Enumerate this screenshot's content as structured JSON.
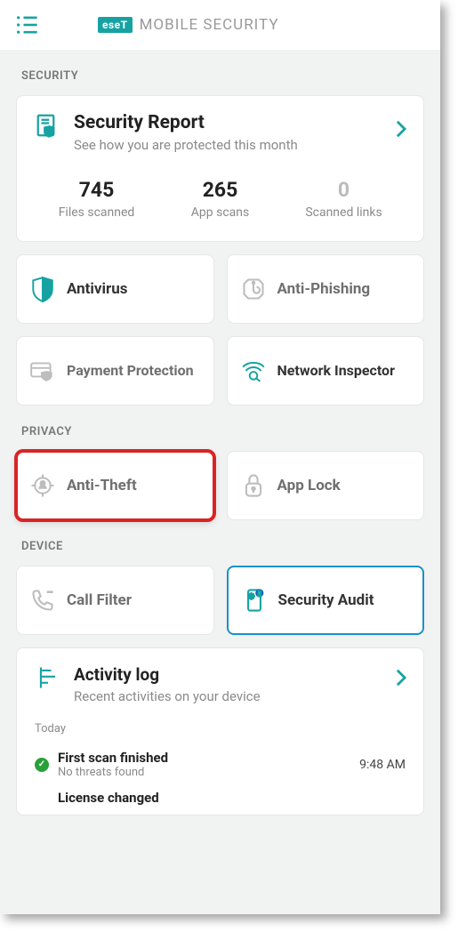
{
  "brand": {
    "logo": "eseT",
    "text": "MOBILE SECURITY"
  },
  "sections": {
    "security": "SECURITY",
    "privacy": "PRIVACY",
    "device": "DEVICE"
  },
  "report": {
    "title": "Security Report",
    "subtitle": "See how you are protected this month",
    "stats": [
      {
        "value": "745",
        "label": "Files scanned"
      },
      {
        "value": "265",
        "label": "App scans"
      },
      {
        "value": "0",
        "label": "Scanned links"
      }
    ]
  },
  "tiles": {
    "antivirus": "Antivirus",
    "antiphishing": "Anti-Phishing",
    "payment": "Payment Protection",
    "network": "Network Inspector",
    "antitheft": "Anti-Theft",
    "applock": "App Lock",
    "callfilter": "Call Filter",
    "securityaudit": "Security Audit"
  },
  "activity": {
    "title": "Activity log",
    "subtitle": "Recent activities on your device",
    "today": "Today",
    "items": [
      {
        "title": "First scan finished",
        "sub": "No threats found",
        "time": "9:48 AM"
      },
      {
        "title": "License changed"
      }
    ]
  }
}
